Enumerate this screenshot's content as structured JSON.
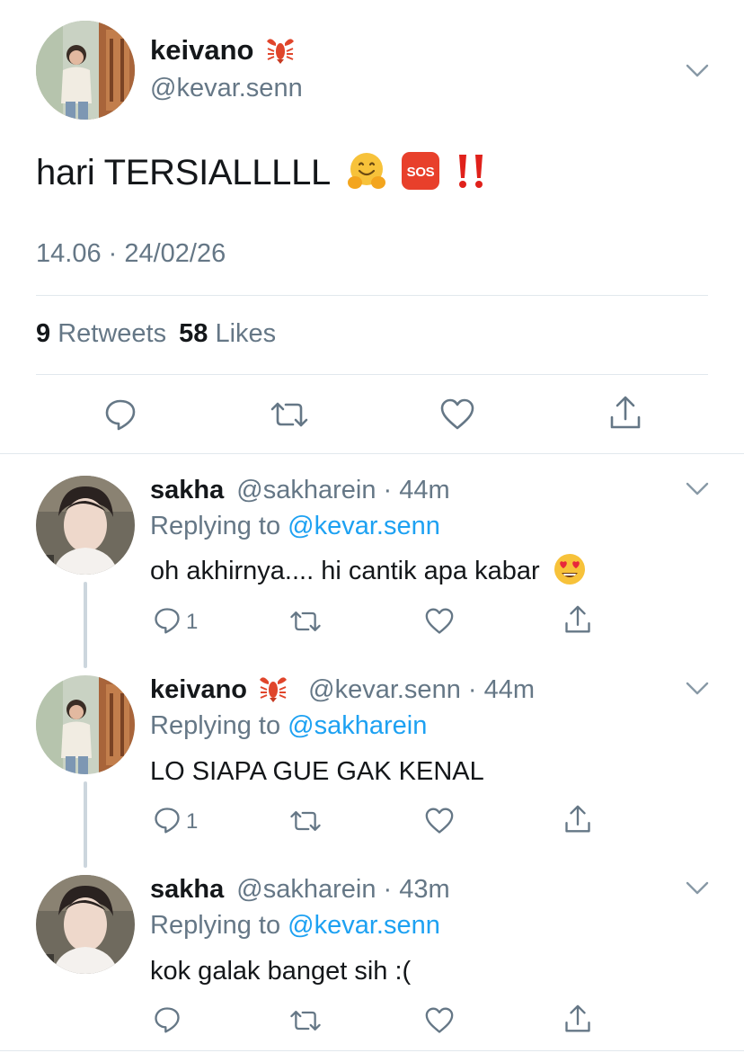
{
  "main_tweet": {
    "name": "keivano",
    "handle": "@kevar.senn",
    "text": "hari TERSIALLLLL",
    "timestamp": "14.06 · 24/02/26",
    "retweets_count": "9",
    "retweets_label": "Retweets",
    "likes_count": "58",
    "likes_label": "Likes"
  },
  "replies": [
    {
      "name": "sakha",
      "handle": "@sakharein",
      "time": "44m",
      "replying_prefix": "Replying to",
      "replying_to": "@kevar.senn",
      "text": "oh akhirnya.... hi cantik apa kabar",
      "reply_count": "1"
    },
    {
      "name": "keivano",
      "handle": "@kevar.senn",
      "time": "44m",
      "replying_prefix": "Replying to",
      "replying_to": "@sakharein",
      "text": "LO SIAPA GUE GAK KENAL",
      "reply_count": "1"
    },
    {
      "name": "sakha",
      "handle": "@sakharein",
      "time": "43m",
      "replying_prefix": "Replying to",
      "replying_to": "@kevar.senn",
      "text": "kok galak banget sih :(",
      "reply_count": ""
    }
  ],
  "colors": {
    "text": "#14171a",
    "secondary": "#657786",
    "link": "#1da1f2",
    "divider": "#e1e8ed",
    "thread_line": "#ccd6dd"
  },
  "icons": [
    "lobster-emoji",
    "hugging-face-emoji",
    "sos-emoji",
    "double-exclamation-emoji",
    "heart-eyes-emoji",
    "chevron-down-icon",
    "reply-icon",
    "retweet-icon",
    "like-icon",
    "share-icon"
  ]
}
